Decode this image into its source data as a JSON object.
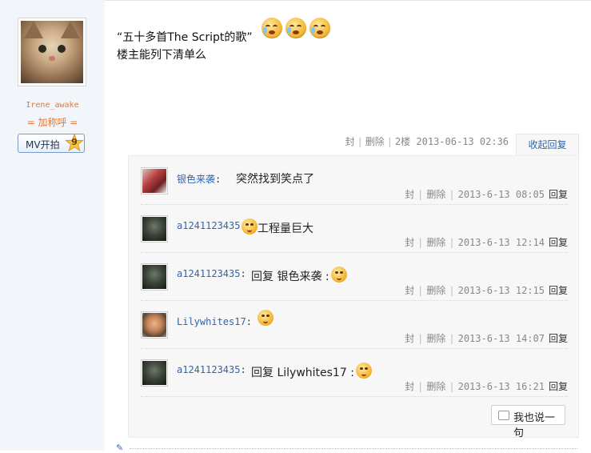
{
  "author": {
    "username": "Irene_awake",
    "nickname": "= 加称呼 =",
    "badge_label": "MV开拍",
    "badge_level": "9"
  },
  "post": {
    "line1": "“五十多首The Script的歌”",
    "line2": "楼主能列下清单么",
    "emojis": [
      "crying-face-icon",
      "crying-face-icon",
      "crying-face-icon"
    ]
  },
  "post_meta": {
    "block": "封",
    "delete": "删除",
    "floor": "2楼",
    "time": "2013-06-13 02:36",
    "collapse": "收起回复"
  },
  "replies": [
    {
      "name": "银色来袭",
      "avatar": "silver",
      "content": "突然找到笑点了",
      "emoji": "",
      "meta_block": "封",
      "meta_delete": "删除",
      "time": "2013-6-13 08:05",
      "reply": "回复"
    },
    {
      "name": "a1241123435",
      "avatar": "dark",
      "content": "工程量巨大",
      "emoji": "sweating-face-icon",
      "meta_block": "封",
      "meta_delete": "删除",
      "time": "2013-6-13 12:14",
      "reply": "回复"
    },
    {
      "name": "a1241123435",
      "avatar": "dark",
      "content": "回复 银色来袭 :",
      "emoji": "sweating-face-icon",
      "meta_block": "封",
      "meta_delete": "删除",
      "time": "2013-6-13 12:15",
      "reply": "回复"
    },
    {
      "name": "Lilywhites17",
      "avatar": "lily",
      "content": "",
      "emoji": "crying-face-icon",
      "meta_block": "封",
      "meta_delete": "删除",
      "time": "2013-6-13 14:07",
      "reply": "回复"
    },
    {
      "name": "a1241123435",
      "avatar": "dark",
      "content": "回复 Lilywhites17 :",
      "emoji": "smiling-face-icon",
      "meta_block": "封",
      "meta_delete": "删除",
      "time": "2013-6-13 16:21",
      "reply": "回复"
    }
  ],
  "say_button": "我也说一句",
  "colors": {
    "link": "#2d64b3",
    "username": "#e8762b",
    "sidebar": "#f2f6fb"
  }
}
